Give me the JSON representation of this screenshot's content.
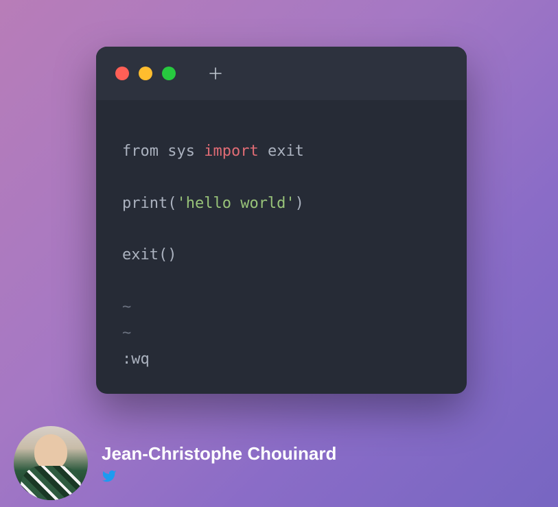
{
  "window": {
    "traffic_lights": [
      "close",
      "minimize",
      "maximize"
    ]
  },
  "code": {
    "lines": [
      [
        {
          "text": "from sys ",
          "cls": "tok-default"
        },
        {
          "text": "import",
          "cls": "tok-keyword"
        },
        {
          "text": " exit",
          "cls": "tok-default"
        }
      ],
      [],
      [
        {
          "text": "print(",
          "cls": "tok-default"
        },
        {
          "text": "'hello world'",
          "cls": "tok-string"
        },
        {
          "text": ")",
          "cls": "tok-default"
        }
      ],
      [],
      [
        {
          "text": "exit()",
          "cls": "tok-default"
        }
      ],
      [],
      [
        {
          "text": "~",
          "cls": "tok-dim"
        }
      ],
      [
        {
          "text": "~",
          "cls": "tok-dim"
        }
      ],
      [
        {
          "text": ":wq",
          "cls": "tok-default"
        }
      ]
    ]
  },
  "author": {
    "name": "Jean-Christophe Chouinard",
    "social_icon": "twitter-icon"
  }
}
